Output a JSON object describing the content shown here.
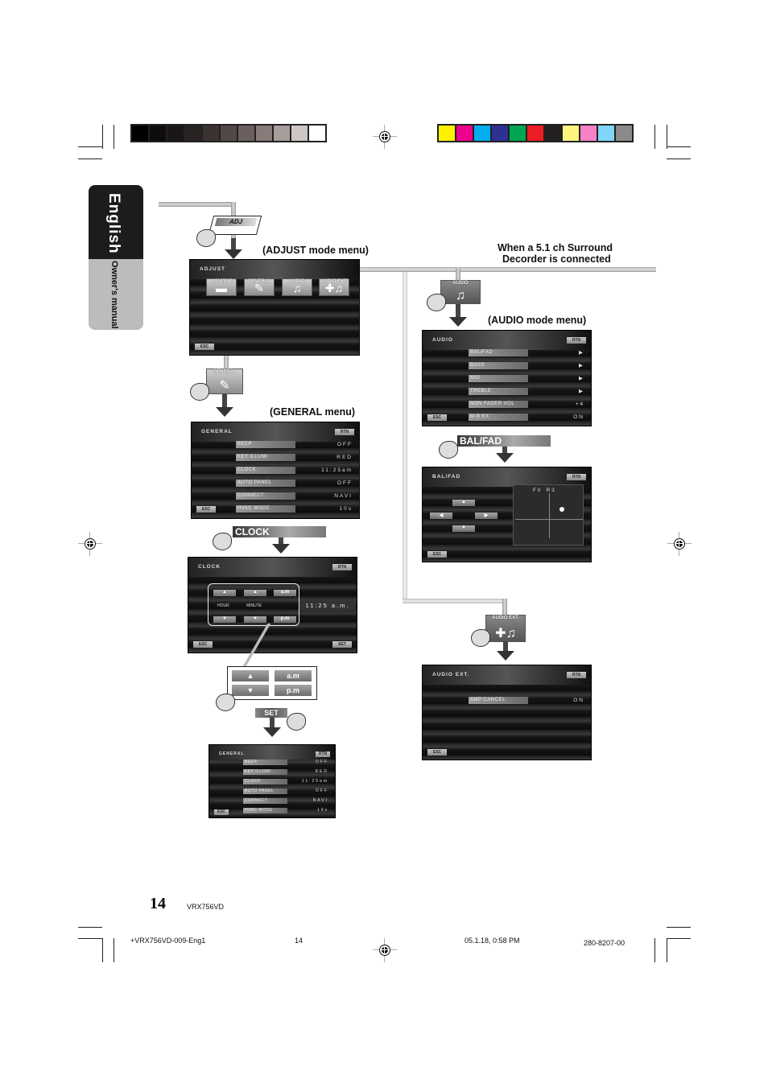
{
  "side_tab": {
    "language": "English",
    "subtitle": "Owner's manual"
  },
  "color_bars": {
    "grayscale": [
      "#000000",
      "#0e0c0c",
      "#1a1616",
      "#282222",
      "#3b3332",
      "#524847",
      "#6b605e",
      "#877c7a",
      "#a79d9b",
      "#cdc6c5",
      "#ffffff"
    ],
    "color": [
      "#fff100",
      "#ec008c",
      "#00aeef",
      "#2e3192",
      "#00a651",
      "#ed1c24",
      "#231f20",
      "#fff57d",
      "#f581c7",
      "#7fd6f8",
      "#8a8a8a"
    ]
  },
  "labels": {
    "adjust_menu": "(ADJUST mode menu)",
    "general_menu": "(GENERAL menu)",
    "audio_menu": "(AUDIO mode menu)",
    "surround_note_line1": "When a 5.1 ch Surround",
    "surround_note_line2": "Decorder is connected"
  },
  "adj_button": "ADJ",
  "adjust_screen": {
    "title": "ADJUST",
    "icons": [
      {
        "label": "MONITOR",
        "glyph": "monitor-icon"
      },
      {
        "label": "GENERAL",
        "glyph": "wrench-icon"
      },
      {
        "label": "AUDIO",
        "glyph": "music-note-icon"
      },
      {
        "label": "AUDIO EXT.",
        "glyph": "music-plus-icon"
      }
    ],
    "esc": "ESC"
  },
  "general_tile": "GENERAL",
  "general_screen": {
    "title": "GENERAL",
    "rtn": "RTN",
    "esc": "ESC",
    "rows": [
      {
        "name": "BEEP",
        "value": "OFF"
      },
      {
        "name": "KEY ILLUMI",
        "value": "RED"
      },
      {
        "name": "CLOCK",
        "value": "11:25am"
      },
      {
        "name": "AUTO PANEL",
        "value": "OFF"
      },
      {
        "name": "CONNECT",
        "value": "NAVI"
      },
      {
        "name": "HVAC MODE",
        "value": "10s"
      }
    ]
  },
  "clock_pill": "CLOCK",
  "clock_screen": {
    "title": "CLOCK",
    "rtn": "RTN",
    "esc": "ESC",
    "set": "SET",
    "hour": "HOUR",
    "minute": "MINUTE",
    "am": "a.m",
    "pm": "p.m",
    "time": "11:25 a.m."
  },
  "clock_zoom": {
    "am": "a.m",
    "pm": "p.m",
    "set": "SET"
  },
  "audio_tile": "AUDIO",
  "audio_screen": {
    "title": "AUDIO",
    "rtn": "RTN",
    "esc": "ESC",
    "rows": [
      {
        "name": "BAL/FAD",
        "value": "▶"
      },
      {
        "name": "BASS",
        "value": "▶"
      },
      {
        "name": "MID",
        "value": "▶"
      },
      {
        "name": "TREBLE",
        "value": "▶"
      },
      {
        "name": "NON FADER VOL",
        "value": "+4"
      },
      {
        "name": "M-B EX",
        "value": "ON"
      }
    ]
  },
  "balfad_pill": "BAL/FAD",
  "balfad_screen": {
    "title": "BAL/FAD",
    "rtn": "RTN",
    "esc": "ESC",
    "readout": "F 0    R 3"
  },
  "audio_ext_tile": "AUDIO EXT.",
  "audio_ext_screen": {
    "title": "AUDIO EXT.",
    "rtn": "RTN",
    "esc": "ESC",
    "rows": [
      {
        "name": "AMP CANCEL",
        "value": "ON"
      }
    ]
  },
  "footer": {
    "page_number": "14",
    "model": "VRX756VD",
    "file": "+VRX756VD-009-Eng1",
    "page_small": "14",
    "timestamp": "05.1.18, 0:58 PM",
    "code": "280-8207-00"
  }
}
